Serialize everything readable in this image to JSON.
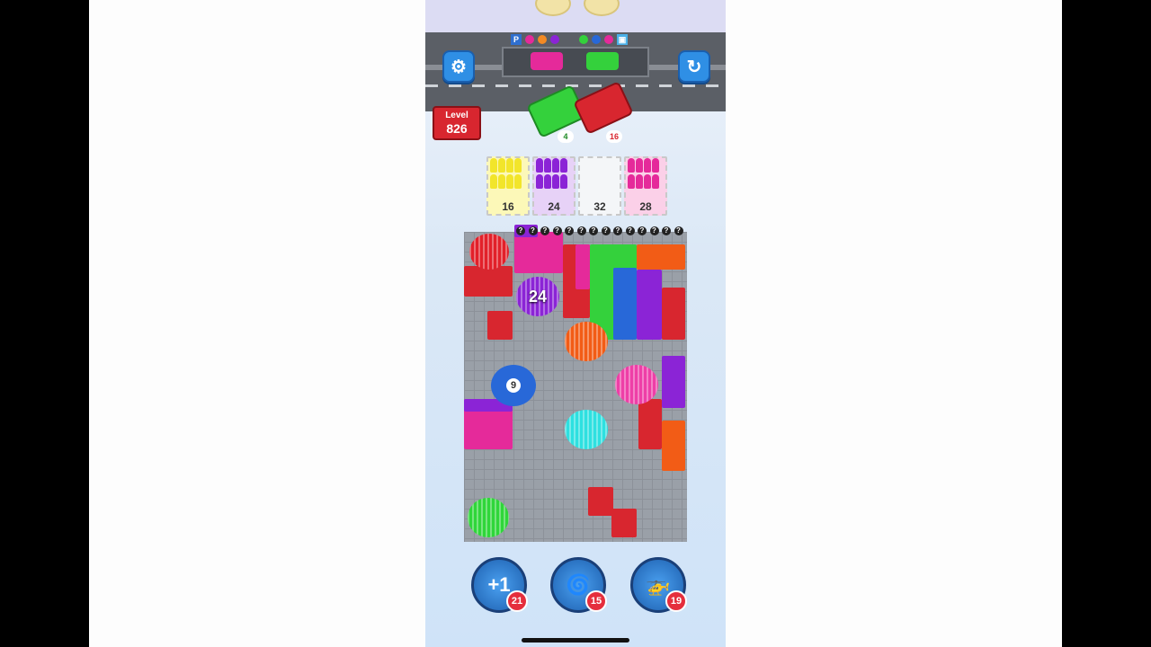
{
  "level": {
    "label": "Level",
    "number": "826"
  },
  "buses": [
    {
      "color": "#34d13c",
      "remaining": "4"
    },
    {
      "color": "#d8262f",
      "remaining": "16"
    }
  ],
  "queues": [
    {
      "color": "#f2e52a",
      "bg": "#fcf8b8",
      "count": "16"
    },
    {
      "color": "#8b24d6",
      "bg": "#e7d2f7",
      "count": "24"
    },
    {
      "color": "#ffffff",
      "bg": "#f4f6f8",
      "count": "32"
    },
    {
      "color": "#e52a9a",
      "bg": "#fbd0e8",
      "count": "28"
    }
  ],
  "holes": [
    {
      "name": "red-hole",
      "color": "#e2202a"
    },
    {
      "name": "purple-hole",
      "color": "#8b24d6",
      "number": "24"
    },
    {
      "name": "orange-hole",
      "color": "#f25c16"
    },
    {
      "name": "blue-bomb-hole",
      "color": "#2868d8",
      "number": "9"
    },
    {
      "name": "pink-hole",
      "color": "#ee3fa7"
    },
    {
      "name": "cyan-hole",
      "color": "#2ee0e0"
    },
    {
      "name": "green-hole",
      "color": "#2fd63a"
    }
  ],
  "boosters": [
    {
      "name": "add-slot",
      "icon": "+1",
      "count": "21"
    },
    {
      "name": "shuffle",
      "icon": "🌀",
      "count": "15"
    },
    {
      "name": "helicopter",
      "icon": "🚁",
      "count": "19"
    }
  ],
  "icons": {
    "settings": "⚙",
    "restart": "↻"
  }
}
